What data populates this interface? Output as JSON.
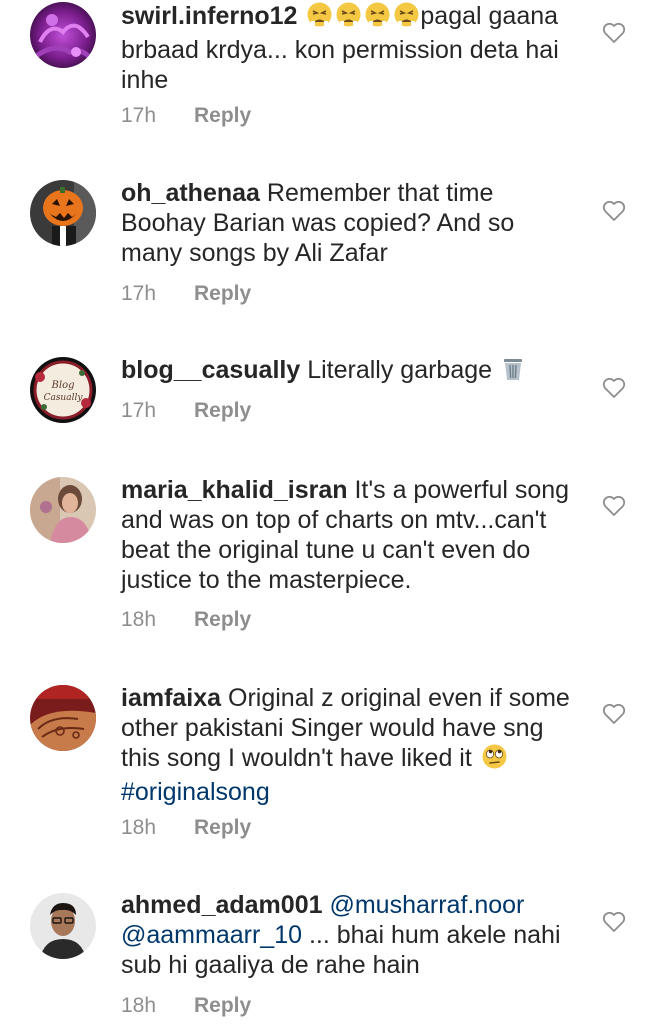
{
  "comments": [
    {
      "username": "swirl.inferno12",
      "emoji_prefix": [
        "tired-face",
        "tired-face",
        "tired-face",
        "tired-face"
      ],
      "lines": [
        "pagal gaana",
        "brbaad krdya... kon permission deta hai",
        "inhe"
      ],
      "time": "17h",
      "reply": "Reply"
    },
    {
      "username": "oh_athenaa",
      "lines": [
        "Remember that time",
        "Boohay Barian was copied? And so",
        "many songs by Ali Zafar"
      ],
      "time": "17h",
      "reply": "Reply"
    },
    {
      "username": "blog__casually",
      "lines": [
        "Literally garbage"
      ],
      "emoji_suffix": "wastebasket",
      "avatar_text": [
        "Blog",
        "Casually"
      ],
      "time": "17h",
      "reply": "Reply"
    },
    {
      "username": "maria_khalid_isran",
      "lines": [
        "It's a powerful song",
        "and was on top of charts on mtv...can't",
        "beat the original tune u can't even do",
        "justice to the masterpiece."
      ],
      "time": "18h",
      "reply": "Reply"
    },
    {
      "username": "iamfaixa",
      "lines": [
        "Original z original even if some",
        "other pakistani Singer would have sng",
        "this song I wouldn't have liked it"
      ],
      "emoji_suffix": "face-with-rolling-eyes",
      "hashtag": "#originalsong",
      "time": "18h",
      "reply": "Reply"
    },
    {
      "username": "ahmed_adam001",
      "mention1": "@musharraf.noor",
      "mention2": "@aammaarr_10",
      "lines": [
        "... bhai hum akele nahi",
        "sub hi gaaliya de rahe hain"
      ],
      "time": "18h",
      "reply": "Reply"
    }
  ],
  "colors": {
    "text": "#262626",
    "meta": "#8e8e8e",
    "link": "#00376b",
    "heart_outline": "#8e8e8e"
  },
  "icons": {
    "like": "heart-outline-icon"
  }
}
